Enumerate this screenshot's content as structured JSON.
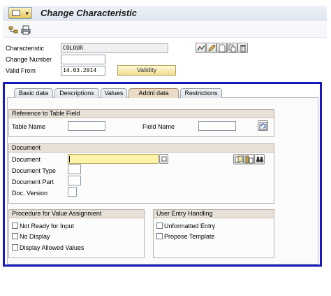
{
  "window": {
    "title": "Change Characteristic"
  },
  "header": {
    "characteristic_label": "Characteristic",
    "characteristic_value": "COLOUR",
    "change_number_label": "Change Number",
    "change_number_value": "",
    "valid_from_label": "Valid From",
    "valid_from_value": "14.03.2014",
    "validity_button": "Validity"
  },
  "tabs": [
    {
      "label": "Basic data"
    },
    {
      "label": "Descriptions"
    },
    {
      "label": "Values"
    },
    {
      "label": "Addnl data",
      "active": true
    },
    {
      "label": "Restrictions"
    }
  ],
  "reference_group": {
    "title": "Reference to Table Field",
    "table_name_label": "Table Name",
    "table_name_value": "",
    "field_name_label": "Field Name",
    "field_name_value": ""
  },
  "document_group": {
    "title": "Document",
    "document_label": "Document",
    "document_value": "",
    "document_type_label": "Document Type",
    "document_part_label": "Document Part",
    "doc_version_label": "Doc. Version"
  },
  "procedure_group": {
    "title": "Procedure for Value Assignment",
    "options": [
      {
        "label": "Not Ready for Input",
        "checked": false
      },
      {
        "label": "No Display",
        "checked": false
      },
      {
        "label": "Display Allowed Values",
        "checked": false
      }
    ]
  },
  "user_entry_group": {
    "title": "User Entry Handling",
    "options": [
      {
        "label": "Unformatted Entry",
        "checked": false
      },
      {
        "label": "Propose Template",
        "checked": false
      }
    ]
  },
  "colors": {
    "highlight_border": "#1a1ab8",
    "required_field": "#fdf3a9",
    "active_tab": "#ecdbc6"
  }
}
